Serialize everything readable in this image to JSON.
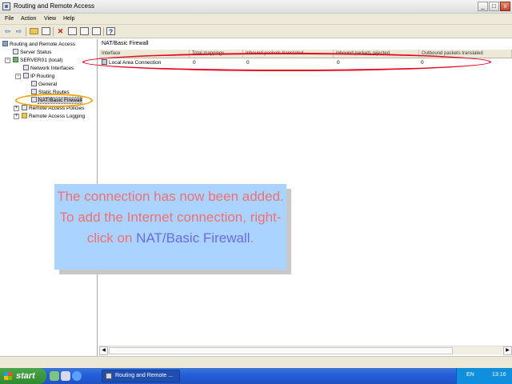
{
  "window": {
    "title": "Routing and Remote Access",
    "controls": [
      "_",
      "□",
      "x"
    ]
  },
  "menu": [
    "File",
    "Action",
    "View",
    "Help"
  ],
  "toolbar": {
    "buttons": [
      "back-icon",
      "forward-icon",
      "up-folder-icon",
      "show-hide-tree-icon",
      "delete-icon",
      "properties-icon",
      "refresh-icon",
      "export-list-icon",
      "help-icon"
    ]
  },
  "tree": {
    "root": "Routing and Remote Access",
    "server_status": "Server Status",
    "server": "SERVER01 (local)",
    "network_interfaces": "Network Interfaces",
    "ip_routing": "IP Routing",
    "general": "General",
    "static_routes": "Static Routes",
    "nat": "NAT/Basic Firewall",
    "remote_access_policies": "Remote Access Policies",
    "remote_access_logging": "Remote Access Logging"
  },
  "details": {
    "pane_title": "NAT/Basic Firewall",
    "columns": [
      "Interface",
      "Total mappings",
      "Inbound packets translated",
      "Inbound packets rejected",
      "Outbound packets translated"
    ],
    "rows": [
      {
        "interface": "Local Area Connection",
        "total_mappings": "0",
        "inbound_translated": "0",
        "inbound_rejected": "0",
        "outbound_translated": "0"
      }
    ]
  },
  "callout": {
    "text_before": "The connection has now been added. To add the Internet connection, right-click on ",
    "highlight": "NAT/Basic Firewall",
    "text_after": ".",
    "text_color": "#f07070",
    "highlight_color": "#6a6ae8",
    "background": "#aad4ff"
  },
  "annotations": {
    "row_ellipse_color": "#e8001a",
    "tree_ellipse_color": "#f0a500"
  },
  "taskbar": {
    "start_label": "start",
    "task_label": "Routing and Remote ...",
    "lang": "EN",
    "clock": "13:16"
  }
}
